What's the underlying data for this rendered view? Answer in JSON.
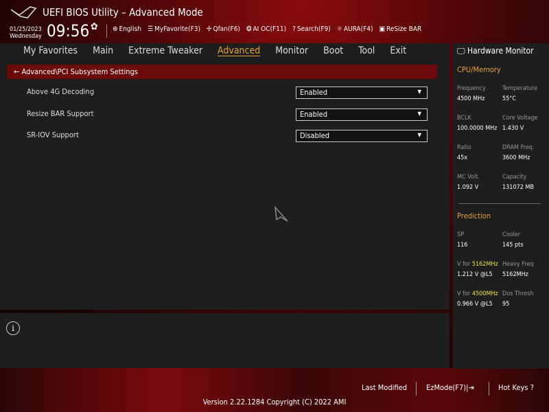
{
  "header": {
    "title": "UEFI BIOS Utility – Advanced Mode",
    "date": "01/25/2023",
    "day": "Wednesday",
    "time": "09:56",
    "tools": [
      {
        "icon": "globe-icon",
        "glyph": "⊕",
        "label": "English"
      },
      {
        "icon": "favorite-list-icon",
        "glyph": "☰",
        "label": "MyFavorite(F3)"
      },
      {
        "icon": "fan-icon",
        "glyph": "✢",
        "label": "Qfan(F6)"
      },
      {
        "icon": "ai-chip-icon",
        "glyph": "❂",
        "label": "AI OC(F11)"
      },
      {
        "icon": "search-icon",
        "glyph": "?",
        "label": "Search(F9)"
      },
      {
        "icon": "aura-icon",
        "glyph": "☼",
        "label": "AURA(F4)"
      },
      {
        "icon": "resize-bar-icon",
        "glyph": "▣",
        "label": "ReSize BAR"
      }
    ]
  },
  "menu": [
    "My Favorites",
    "Main",
    "Extreme Tweaker",
    "Advanced",
    "Monitor",
    "Boot",
    "Tool",
    "Exit"
  ],
  "breadcrumb": "Advanced\\PCI Subsystem Settings",
  "settings": [
    {
      "label": "Above 4G Decoding",
      "value": "Enabled"
    },
    {
      "label": "Resize BAR Support",
      "value": "Enabled"
    },
    {
      "label": "SR-IOV Support",
      "value": "Disabled"
    }
  ],
  "hw": {
    "title": "Hardware Monitor",
    "cpu_title": "CPU/Memory",
    "cpu": [
      {
        "l": "Frequency",
        "v": "4500 MHz"
      },
      {
        "l": "Temperature",
        "v": "55°C"
      },
      {
        "l": "BCLK",
        "v": "100.0000 MHz"
      },
      {
        "l": "Core Voltage",
        "v": "1.430 V"
      },
      {
        "l": "Ratio",
        "v": "45x"
      },
      {
        "l": "DRAM Freq.",
        "v": "3600 MHz"
      },
      {
        "l": "MC Volt.",
        "v": "1.092 V"
      },
      {
        "l": "Capacity",
        "v": "131072 MB"
      }
    ],
    "pred_title": "Prediction",
    "pred": [
      {
        "l": "SP",
        "v": "116"
      },
      {
        "l": "Cooler",
        "v": "145 pts"
      },
      {
        "l": "V for ",
        "h": "5162MHz",
        "v": "1.212 V @L5"
      },
      {
        "l": "Heavy Freq",
        "v": "5162MHz"
      },
      {
        "l": "V for ",
        "h": "4500MHz",
        "v": "0.966 V @L5"
      },
      {
        "l": "Dos Thresh",
        "v": "95"
      }
    ]
  },
  "footer": {
    "last_modified": "Last Modified",
    "ezmode": "EzMode(F7)|⇥",
    "hotkeys": "Hot Keys ?",
    "version": "Version 2.22.1284 Copyright (C) 2022 AMI"
  }
}
